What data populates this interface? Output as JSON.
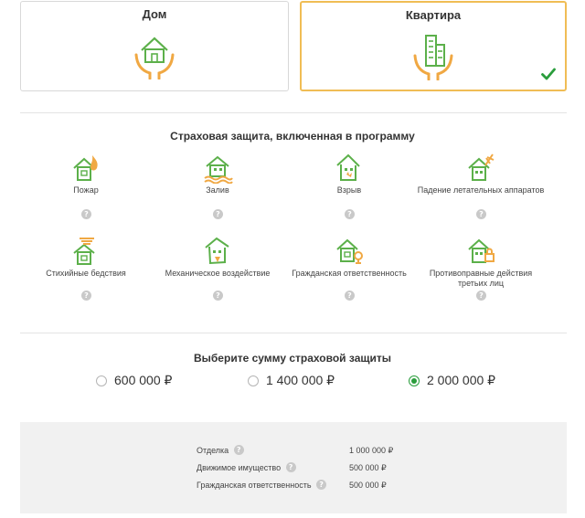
{
  "property_types": [
    {
      "label": "Дом",
      "selected": false,
      "icon": "house-hands-icon"
    },
    {
      "label": "Квартира",
      "selected": true,
      "icon": "apartment-building-hands-icon"
    }
  ],
  "coverage": {
    "title": "Страховая защита, включенная в программу",
    "risks": [
      {
        "label": "Пожар",
        "icon": "house-fire-icon"
      },
      {
        "label": "Залив",
        "icon": "house-flood-icon"
      },
      {
        "label": "Взрыв",
        "icon": "house-explosion-icon"
      },
      {
        "label": "Падение летательных аппаратов",
        "icon": "house-aircraft-icon"
      },
      {
        "label": "Стихийные бедствия",
        "icon": "house-tornado-icon"
      },
      {
        "label": "Механическое воздействие",
        "icon": "house-damage-icon"
      },
      {
        "label": "Гражданская ответственность",
        "icon": "house-liability-icon"
      },
      {
        "label": "Противоправные действия третьих лиц",
        "icon": "house-burglary-icon"
      }
    ],
    "help_glyph": "?"
  },
  "sum_selection": {
    "title": "Выберите сумму страховой защиты",
    "options": [
      {
        "amount": "600 000 ₽",
        "selected": false
      },
      {
        "amount": "1 400 000 ₽",
        "selected": false
      },
      {
        "amount": "2 000 000 ₽",
        "selected": true
      }
    ]
  },
  "summary": {
    "rows": [
      {
        "label": "Отделка",
        "value": "1 000 000 ₽"
      },
      {
        "label": "Движимое имущество",
        "value": "500 000 ₽"
      },
      {
        "label": "Гражданская ответственность",
        "value": "500 000 ₽"
      }
    ]
  },
  "colors": {
    "accent_green": "#2a9d3c",
    "accent_orange": "#f0bd55",
    "icon_green": "#5cb04a"
  }
}
